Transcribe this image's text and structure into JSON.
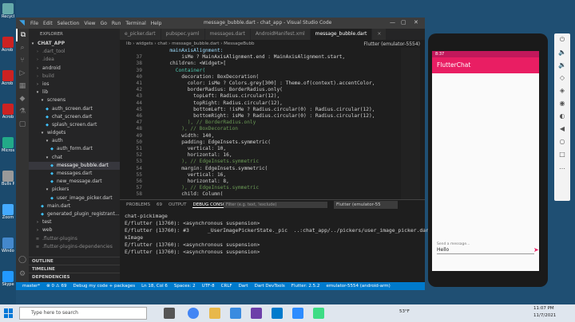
{
  "desktop": {
    "icons": [
      {
        "label": "Recycle",
        "color": "#6aa"
      },
      {
        "label": "Acrob Reade",
        "color": "#c22"
      },
      {
        "label": "Acrob Reade",
        "color": "#c22"
      },
      {
        "label": "Acrob",
        "color": "#c22"
      },
      {
        "label": "Micros",
        "color": "#2a8"
      },
      {
        "label": "Bulls Prims",
        "color": "#999"
      },
      {
        "label": "Zoom",
        "color": "#4af"
      },
      {
        "label": "Window",
        "color": "#48c"
      },
      {
        "label": "Skype",
        "color": "#29f"
      }
    ]
  },
  "vscode": {
    "title": "message_bubble.dart - chat_app - Visual Studio Code",
    "menu": [
      "File",
      "Edit",
      "Selection",
      "View",
      "Go",
      "Run",
      "Terminal",
      "Help"
    ],
    "activity": [
      {
        "name": "explorer-icon",
        "glyph": "⧉"
      },
      {
        "name": "search-icon",
        "glyph": "⌕"
      },
      {
        "name": "source-control-icon",
        "glyph": "⑂"
      },
      {
        "name": "debug-icon",
        "glyph": "▷"
      },
      {
        "name": "extensions-icon",
        "glyph": "▦"
      },
      {
        "name": "flutter-icon",
        "glyph": "◆"
      },
      {
        "name": "test-icon",
        "glyph": "⚗"
      },
      {
        "name": "remote-icon",
        "glyph": "▢"
      },
      {
        "name": "account-icon",
        "glyph": "◯"
      },
      {
        "name": "settings-icon",
        "glyph": "⚙"
      }
    ],
    "explorer": {
      "header": "EXPLORER",
      "items": [
        {
          "label": "CHAT_APP",
          "icon": "▾",
          "indent": 0,
          "color": "#ccc",
          "bold": true
        },
        {
          "label": ".dart_tool",
          "icon": "›",
          "indent": 1,
          "color": "#888"
        },
        {
          "label": ".idea",
          "icon": "›",
          "indent": 1,
          "color": "#888"
        },
        {
          "label": "android",
          "icon": "›",
          "indent": 1,
          "color": "#ccc"
        },
        {
          "label": "build",
          "icon": "›",
          "indent": 1,
          "color": "#888"
        },
        {
          "label": "ios",
          "icon": "›",
          "indent": 1,
          "color": "#ccc"
        },
        {
          "label": "lib",
          "icon": "▾",
          "indent": 1,
          "color": "#ccc"
        },
        {
          "label": "screens",
          "icon": "▾",
          "indent": 2,
          "color": "#ccc"
        },
        {
          "label": "auth_screen.dart",
          "icon": "◆",
          "indent": 3,
          "color": "#ccc"
        },
        {
          "label": "chat_screen.dart",
          "icon": "◆",
          "indent": 3,
          "color": "#ccc"
        },
        {
          "label": "splash_screen.dart",
          "icon": "◆",
          "indent": 3,
          "color": "#ccc"
        },
        {
          "label": "widgets",
          "icon": "▾",
          "indent": 2,
          "color": "#ccc"
        },
        {
          "label": "auth",
          "icon": "▾",
          "indent": 3,
          "color": "#ccc"
        },
        {
          "label": "auth_form.dart",
          "icon": "◆",
          "indent": 4,
          "color": "#ccc"
        },
        {
          "label": "chat",
          "icon": "▾",
          "indent": 3,
          "color": "#ccc"
        },
        {
          "label": "message_bubble.dart",
          "icon": "◆",
          "indent": 4,
          "color": "#fff",
          "selected": true
        },
        {
          "label": "messages.dart",
          "icon": "◆",
          "indent": 4,
          "color": "#ccc"
        },
        {
          "label": "new_message.dart",
          "icon": "◆",
          "indent": 4,
          "color": "#ccc"
        },
        {
          "label": "pickers",
          "icon": "▾",
          "indent": 3,
          "color": "#ccc"
        },
        {
          "label": "user_image_picker.dart",
          "icon": "◆",
          "indent": 4,
          "color": "#ccc"
        },
        {
          "label": "main.dart",
          "icon": "◆",
          "indent": 2,
          "color": "#ccc"
        },
        {
          "label": "generated_plugin_registrant...",
          "icon": "◆",
          "indent": 2,
          "color": "#ccc"
        },
        {
          "label": "test",
          "icon": "›",
          "indent": 1,
          "color": "#ccc"
        },
        {
          "label": "web",
          "icon": "›",
          "indent": 1,
          "color": "#ccc"
        },
        {
          "label": ".flutter-plugins",
          "icon": "≡",
          "indent": 1,
          "color": "#888"
        },
        {
          "label": ".flutter-plugins-dependencies",
          "icon": "≡",
          "indent": 1,
          "color": "#888"
        }
      ],
      "outline": "OUTLINE",
      "timeline": "TIMELINE",
      "dependencies": "DEPENDENCIES"
    },
    "tabs": [
      "e_picker.dart",
      "pubspec.yaml",
      "messages.dart",
      "AndroidManifest.xml",
      "message_bubble.dart",
      "×"
    ],
    "breadcrumb": "lib › widgets › chat › message_bubble.dart › MessageBubb",
    "device_select": "Flutter (emulator-5554)",
    "code": [
      {
        "n": "",
        "t": "      mainAxisAlignment:",
        "c": "#9cdcfe"
      },
      {
        "n": "37",
        "t": "          isMe ? MainAxisAlignment.end : MainAxisAlignment.start,",
        "c": "#d4d4d4"
      },
      {
        "n": "38",
        "t": "      children: <Widget>[",
        "c": "#d4d4d4"
      },
      {
        "n": "39",
        "t": "        Container(",
        "c": "#4ec9b0"
      },
      {
        "n": "40",
        "t": "          decoration: BoxDecoration(",
        "c": "#d4d4d4"
      },
      {
        "n": "41",
        "t": "            color: isMe ? Colors.grey[300] : Theme.of(context).accentColor,",
        "c": "#d4d4d4"
      },
      {
        "n": "42",
        "t": "            borderRadius: BorderRadius.only(",
        "c": "#d4d4d4"
      },
      {
        "n": "43",
        "t": "              topLeft: Radius.circular(12),",
        "c": "#d4d4d4"
      },
      {
        "n": "44",
        "t": "              topRight: Radius.circular(12),",
        "c": "#d4d4d4"
      },
      {
        "n": "45",
        "t": "              bottomLeft: !isMe ? Radius.circular(0) : Radius.circular(12),",
        "c": "#d4d4d4"
      },
      {
        "n": "46",
        "t": "              bottomRight: isMe ? Radius.circular(0) : Radius.circular(12),",
        "c": "#d4d4d4"
      },
      {
        "n": "47",
        "t": "            ), // BorderRadius.only",
        "c": "#6a9955"
      },
      {
        "n": "48",
        "t": "          ), // BoxDecoration",
        "c": "#6a9955"
      },
      {
        "n": "49",
        "t": "          width: 140,",
        "c": "#d4d4d4"
      },
      {
        "n": "50",
        "t": "          padding: EdgeInsets.symmetric(",
        "c": "#d4d4d4"
      },
      {
        "n": "51",
        "t": "            vertical: 10,",
        "c": "#d4d4d4"
      },
      {
        "n": "52",
        "t": "            horizontal: 16,",
        "c": "#d4d4d4"
      },
      {
        "n": "53",
        "t": "          ), // EdgeInsets.symmetric",
        "c": "#6a9955"
      },
      {
        "n": "54",
        "t": "          margin: EdgeInsets.symmetric(",
        "c": "#d4d4d4"
      },
      {
        "n": "55",
        "t": "            vertical: 16,",
        "c": "#d4d4d4"
      },
      {
        "n": "56",
        "t": "            horizontal: 8,",
        "c": "#d4d4d4"
      },
      {
        "n": "57",
        "t": "          ), // EdgeInsets.symmetric",
        "c": "#6a9955"
      },
      {
        "n": "58",
        "t": "          child: Column(",
        "c": "#d4d4d4"
      }
    ],
    "panel": {
      "tabs": [
        "PROBLEMS",
        "69",
        "OUTPUT",
        "DEBUG CONSOLE",
        "..."
      ],
      "filter": "Filter (e.g. text, !exclude)",
      "emulator": "Flutter (emulator-55",
      "lines": [
        "chat-pickimage",
        "E/flutter (13760): <asynchronous suspension>",
        "E/flutter (13760): #3      _UserImagePickerState._pic  ..:chat_app/../pickers/user_image_picker.dart:27",
        "kImage",
        "E/flutter (13760): <asynchronous suspension>",
        "E/flutter (13760): <asynchronous suspension>"
      ]
    },
    "status": [
      "master*",
      "⊗ 0 ⚠ 69",
      "Debug my code + packages",
      "Ln 18, Col 6",
      "Spaces: 2",
      "UTF-8",
      "CRLF",
      "Dart",
      "Dart DevTools",
      "Flutter: 2.5.2",
      "emulator-5554 (android-arm)"
    ]
  },
  "emulator": {
    "time": "8:37",
    "app_title": "FlutterChat",
    "message_label": "Send a message...",
    "message_value": "Hello",
    "send_icon": "send-icon"
  },
  "emulator_toolbar": [
    "⏻",
    "🔈",
    "🔉",
    "◇",
    "◈",
    "◉",
    "◐",
    "◀",
    "○",
    "□",
    "…"
  ],
  "taskbar": {
    "search_placeholder": "Type here to search",
    "weather": "53°F",
    "time": "11:07 PM",
    "date": "11/7/2021"
  }
}
